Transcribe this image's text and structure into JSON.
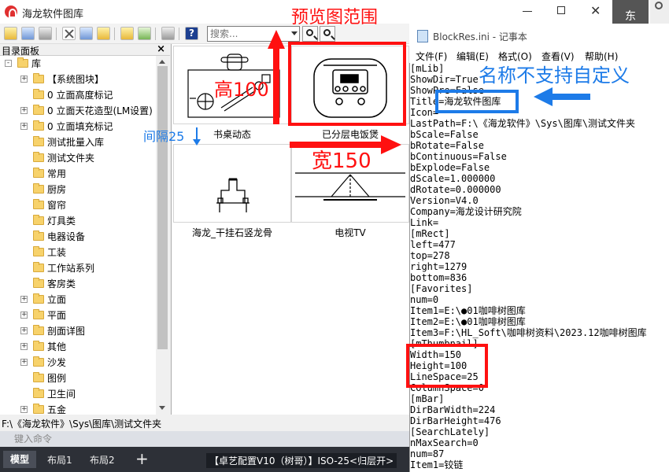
{
  "app": {
    "title": "海龙软件图库"
  },
  "toolbar": {
    "search_placeholder": "搜索..."
  },
  "directory": {
    "header": "目录面板",
    "close": "×",
    "tree": [
      {
        "label": "库",
        "level": 0,
        "expand": "-"
      },
      {
        "label": "【系统图块】",
        "level": 1,
        "expand": "+"
      },
      {
        "label": "0 立面高度标记",
        "level": 1,
        "expand": ""
      },
      {
        "label": "0 立面天花造型(LM设置)",
        "level": 1,
        "expand": "+"
      },
      {
        "label": "0 立面填充标记",
        "level": 1,
        "expand": "+"
      },
      {
        "label": "测试批量入库",
        "level": 1,
        "expand": ""
      },
      {
        "label": "测试文件夹",
        "level": 1,
        "expand": ""
      },
      {
        "label": "常用",
        "level": 1,
        "expand": ""
      },
      {
        "label": "厨房",
        "level": 1,
        "expand": ""
      },
      {
        "label": "窗帘",
        "level": 1,
        "expand": ""
      },
      {
        "label": "灯具类",
        "level": 1,
        "expand": ""
      },
      {
        "label": "电器设备",
        "level": 1,
        "expand": ""
      },
      {
        "label": "工装",
        "level": 1,
        "expand": ""
      },
      {
        "label": "工作站系列",
        "level": 1,
        "expand": ""
      },
      {
        "label": "客房类",
        "level": 1,
        "expand": ""
      },
      {
        "label": "立面",
        "level": 1,
        "expand": "+"
      },
      {
        "label": "平面",
        "level": 1,
        "expand": "+"
      },
      {
        "label": "剖面详图",
        "level": 1,
        "expand": "+"
      },
      {
        "label": "其他",
        "level": 1,
        "expand": "+"
      },
      {
        "label": "沙发",
        "level": 1,
        "expand": "+"
      },
      {
        "label": "图例",
        "level": 1,
        "expand": ""
      },
      {
        "label": "卫生间",
        "level": 1,
        "expand": ""
      },
      {
        "label": "五金",
        "level": 1,
        "expand": "+"
      }
    ]
  },
  "previews": [
    {
      "caption": "书桌动态",
      "icon": "desk-drawing"
    },
    {
      "caption": "已分层电饭煲",
      "icon": "rice-cooker-drawing"
    },
    {
      "caption": "海龙_干挂石竖龙骨",
      "icon": "stone-keel-drawing"
    },
    {
      "caption": "电视TV",
      "icon": "tv-drawing"
    }
  ],
  "path": "F:\\《海龙软件》\\Sys\\图库\\测试文件夹",
  "command": {
    "placeholder": "键入命令"
  },
  "layout_tabs": [
    "模型",
    "布局1",
    "布局2",
    "+"
  ],
  "status": "【卓艺配置V10（树哥）】ISO-25<归层开>",
  "notepad": {
    "title": "BlockRes.ini - 记事本",
    "menus": [
      "文件(F)",
      "编辑(E)",
      "格式(O)",
      "查看(V)",
      "帮助(H)"
    ],
    "lines": [
      "[mLib]",
      "ShowDir=True",
      "ShowPre=False",
      "Title=海龙软件图库",
      "Icon=",
      "LastPath=F:\\《海龙软件》\\Sys\\图库\\测试文件夹",
      "bScale=False",
      "bRotate=False",
      "bContinuous=False",
      "bExplode=False",
      "dScale=1.000000",
      "dRotate=0.000000",
      "Version=V4.0",
      "Company=海龙设计研究院",
      "Link=",
      "[mRect]",
      "left=477",
      "top=278",
      "right=1279",
      "bottom=836",
      "[Favorites]",
      "num=0",
      "Item1=E:\\●01咖啡树图库",
      "Item2=E:\\●01咖啡树图库",
      "Item3=F:\\HL_Soft\\咖啡树资料\\2023.12咖啡树图库",
      "[mThumbnail]",
      "Width=150",
      "Height=100",
      "LineSpace=25",
      "ColumnSpace=0",
      "[mBar]",
      "DirBarWidth=224",
      "DirBarHeight=476",
      "[SearchLately]",
      "nMaxSearch=0",
      "num=87",
      "Item1=铰链"
    ]
  },
  "outer": {
    "dark_tab": "东"
  },
  "annotations": {
    "preview_range": "预览图范围",
    "height": "高100",
    "width": "宽150",
    "gap": "间隔25",
    "name_note": "名称不支持自定义"
  },
  "colors": {
    "annotation_red": "#ff1010",
    "annotation_blue": "#1d7be8"
  }
}
